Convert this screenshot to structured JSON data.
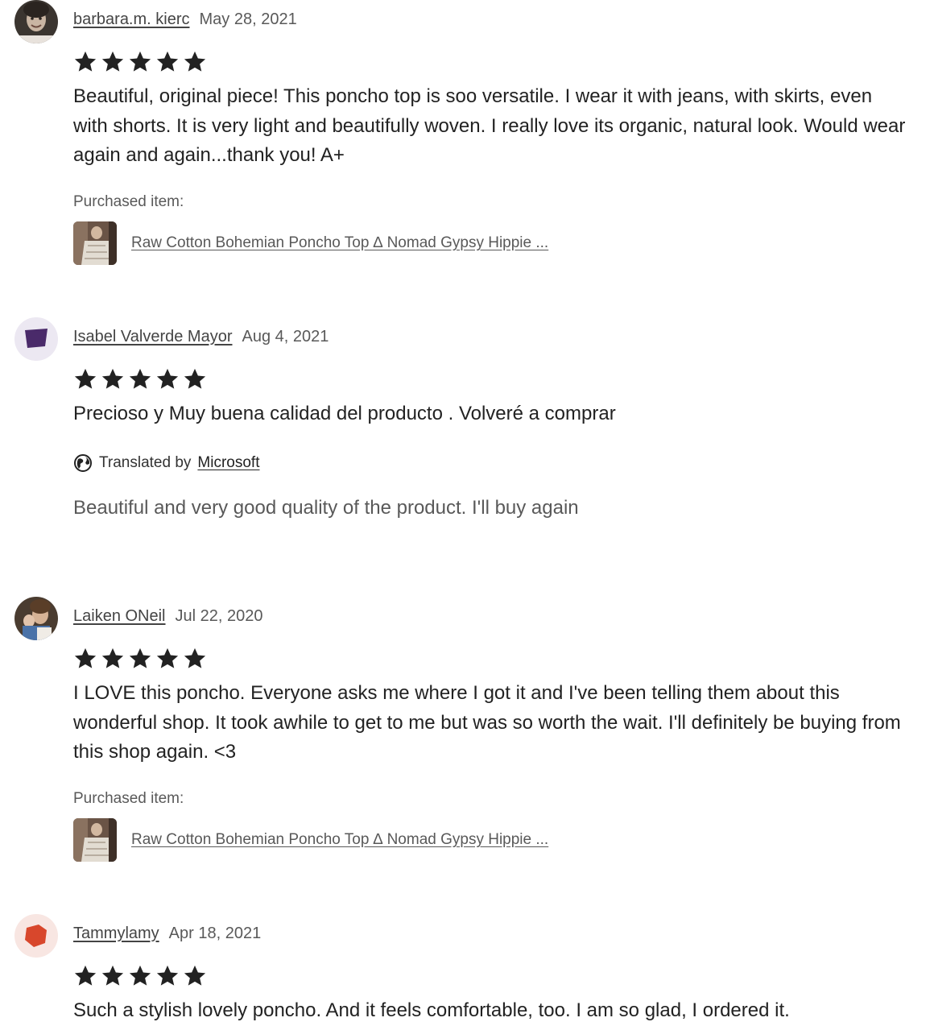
{
  "reviews": [
    {
      "name": "barbara.m. kierc",
      "date": "May 28, 2021",
      "rating": 5,
      "text": "Beautiful, original piece! This poncho top is soo versatile. I wear it with jeans, with skirts, even with shorts. It is very light and beautifully woven. I really love its organic, natural look. Would wear again and again...thank you! A+",
      "purchased_label": "Purchased item:",
      "item_title": "Raw Cotton Bohemian Poncho Top ∆ Nomad Gypsy Hippie ..."
    },
    {
      "name": "Isabel Valverde Mayor",
      "date": "Aug 4, 2021",
      "rating": 5,
      "text": "Precioso y Muy buena calidad del producto . Volveré a comprar",
      "translated_prefix": "Translated by",
      "translated_by": "Microsoft",
      "translation": "Beautiful and very good quality of the product. I'll buy again"
    },
    {
      "name": "Laiken ONeil",
      "date": "Jul 22, 2020",
      "rating": 5,
      "text": "I LOVE this poncho. Everyone asks me where I got it and I've been telling them about this wonderful shop. It took awhile to get to me but was so worth the wait. I'll definitely be buying from this shop again. <3",
      "purchased_label": "Purchased item:",
      "item_title": "Raw Cotton Bohemian Poncho Top ∆ Nomad Gypsy Hippie ..."
    },
    {
      "name": "Tammylamy",
      "date": "Apr 18, 2021",
      "rating": 5,
      "text": "Such a stylish lovely poncho. And it feels comfortable, too. I am so glad, I ordered it."
    }
  ],
  "colors": {
    "star": "#222222",
    "link": "#595959",
    "avatar_purple_bg": "#ece8f2",
    "avatar_purple": "#4a2a6a",
    "avatar_red_bg": "#f8e6e2",
    "avatar_red": "#d8472c"
  }
}
